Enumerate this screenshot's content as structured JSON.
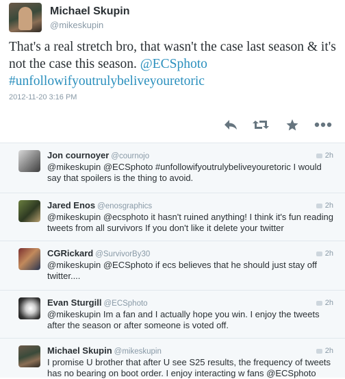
{
  "tweet": {
    "author_name": "Michael Skupin",
    "author_handle": "@mikeskupin",
    "text_plain": "That's a real stretch bro, that wasn't the case last season & it's not the case this season.",
    "mention": "@ECSphoto",
    "hashtag": "#unfollowifyoutrulybeliveyouretoric",
    "timestamp": "2012-11-20 3:16 PM"
  },
  "actions": {
    "reply_icon": "reply-arrow-icon",
    "retweet_icon": "retweet-icon",
    "favorite_icon": "star-icon",
    "more_icon": "more-dots-icon"
  },
  "replies": [
    {
      "name": "Jon cournoyer",
      "handle": "@cournojo",
      "time": "2h",
      "text": "@mikeskupin @ECSphoto #unfollowifyoutrulybeliveyouretoric I would say that spoilers is the thing to avoid."
    },
    {
      "name": "Jared Enos",
      "handle": "@enosgraphics",
      "time": "2h",
      "text": "@mikeskupin @ecsphoto it hasn't ruined anything! I think it's fun reading tweets from all survivors If you don't like it delete your twitter"
    },
    {
      "name": "CGRickard",
      "handle": "@SurvivorBy30",
      "time": "2h",
      "text": "@mikeskupin @ECSphoto if ecs believes that he should just stay off twitter...."
    },
    {
      "name": "Evan Sturgill",
      "handle": "@ECSphoto",
      "time": "2h",
      "text": "@mikeskupin Im a fan and I actually hope you win. I enjoy the tweets after the season or after someone is voted off."
    },
    {
      "name": "Michael Skupin",
      "handle": "@mikeskupin",
      "time": "2h",
      "text": "I promise U brother that after U see S25 results, the frequency of tweets has no bearing on boot order. I enjoy interacting w fans @ECSphoto"
    }
  ],
  "colors": {
    "link": "#2a8fbd",
    "muted": "#8899a6",
    "text": "#292f33",
    "reply_bg": "#f5f8fa"
  }
}
